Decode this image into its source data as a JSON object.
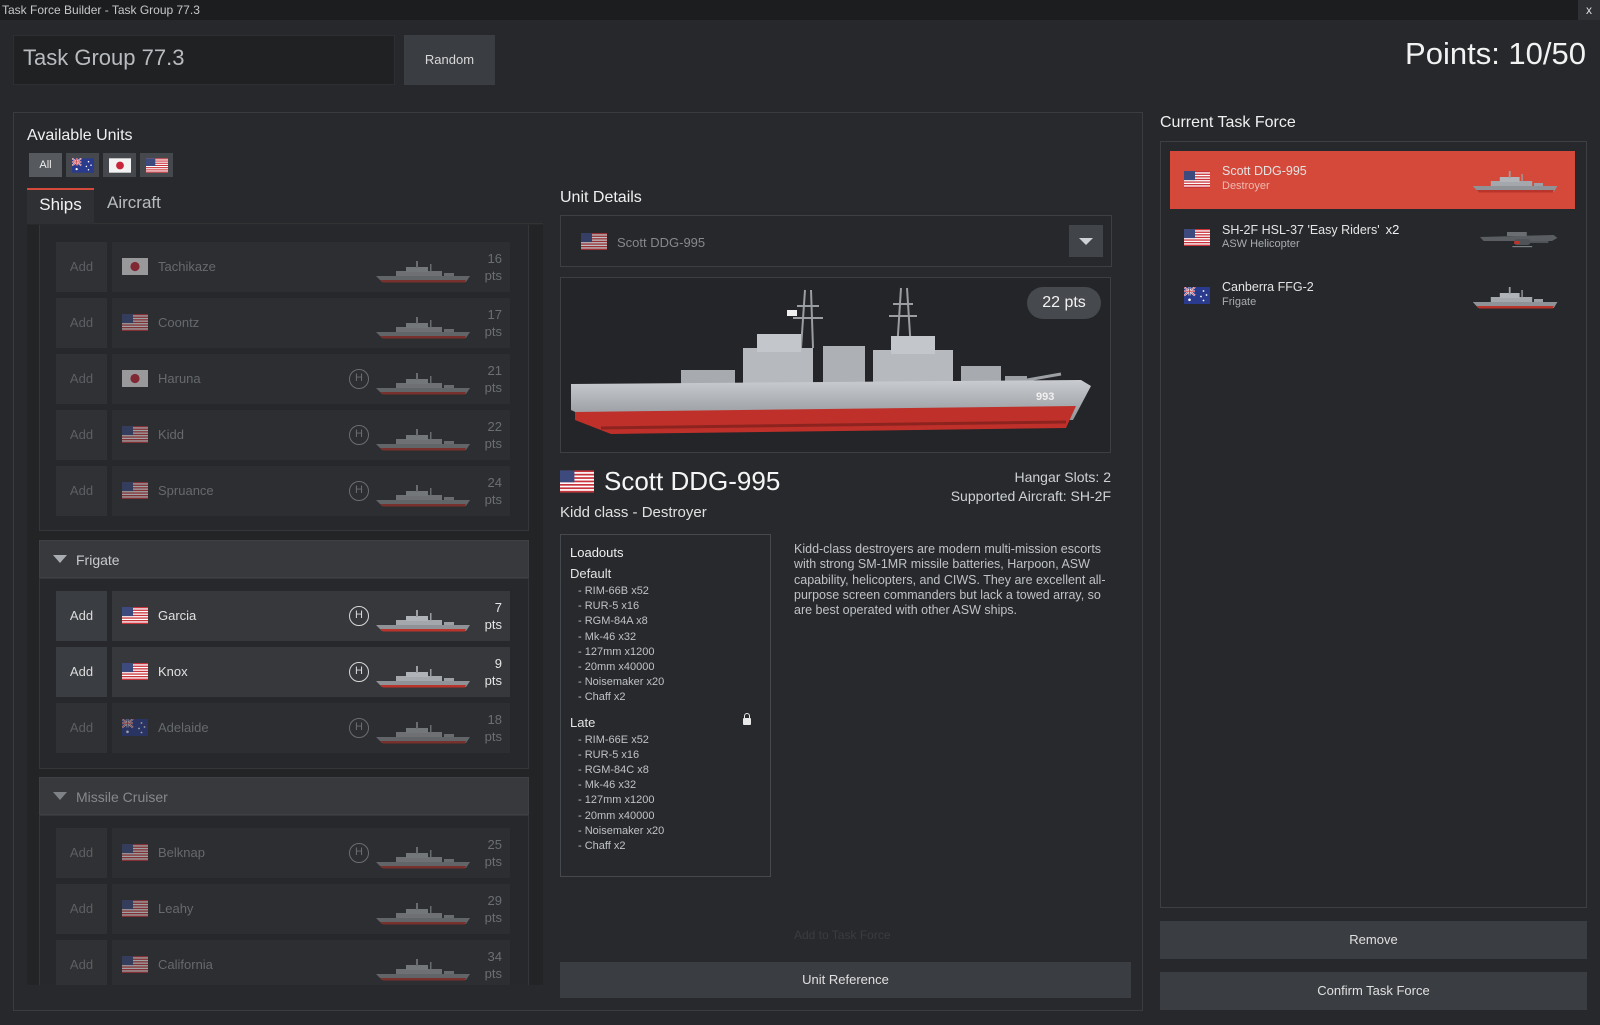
{
  "window": {
    "title": "Task Force Builder - Task Group 77.3",
    "close_label": "x"
  },
  "header": {
    "task_group_name": "Task Group 77.3",
    "random_label": "Random",
    "points": "Points: 10/50"
  },
  "available": {
    "title": "Available Units",
    "filters": [
      {
        "label": "All",
        "icon": "all"
      },
      {
        "label": "",
        "icon": "flag-australia"
      },
      {
        "label": "",
        "icon": "flag-japan"
      },
      {
        "label": "",
        "icon": "flag-usa"
      }
    ],
    "tabs": {
      "ships": "Ships",
      "aircraft": "Aircraft"
    },
    "add_label": "Add",
    "heli_glyph": "H",
    "destroyer_rows": [
      {
        "name": "Tachikaze",
        "flag": "japan",
        "heli": false,
        "pts": "16",
        "unit": "pts"
      },
      {
        "name": "Coontz",
        "flag": "usa",
        "heli": false,
        "pts": "17",
        "unit": "pts"
      },
      {
        "name": "Haruna",
        "flag": "japan",
        "heli": true,
        "pts": "21",
        "unit": "pts"
      },
      {
        "name": "Kidd",
        "flag": "usa",
        "heli": true,
        "pts": "22",
        "unit": "pts"
      },
      {
        "name": "Spruance",
        "flag": "usa",
        "heli": true,
        "pts": "24",
        "unit": "pts"
      }
    ],
    "frigate": {
      "label": "Frigate",
      "rows": [
        {
          "name": "Garcia",
          "flag": "usa",
          "heli": true,
          "pts": "7",
          "unit": "pts",
          "enabled": true
        },
        {
          "name": "Knox",
          "flag": "usa",
          "heli": true,
          "pts": "9",
          "unit": "pts",
          "enabled": true
        },
        {
          "name": "Adelaide",
          "flag": "australia",
          "heli": true,
          "pts": "18",
          "unit": "pts",
          "enabled": false
        }
      ]
    },
    "cruiser": {
      "label": "Missile Cruiser",
      "rows": [
        {
          "name": "Belknap",
          "flag": "usa",
          "heli": true,
          "pts": "25",
          "unit": "pts"
        },
        {
          "name": "Leahy",
          "flag": "usa",
          "heli": false,
          "pts": "29",
          "unit": "pts"
        },
        {
          "name": "California",
          "flag": "usa",
          "heli": false,
          "pts": "34",
          "unit": "pts"
        }
      ]
    }
  },
  "details": {
    "title": "Unit Details",
    "selected": "Scott DDG-995",
    "points_badge": "22 pts",
    "unit_name": "Scott DDG-995",
    "unit_class": "Kidd class - Destroyer",
    "hangar": "Hangar Slots: 2",
    "supported": "Supported Aircraft: SH-2F",
    "loadouts_title": "Loadouts",
    "loadout_default": {
      "name": "Default",
      "items": [
        "RIM-66B x52",
        "RUR-5 x16",
        "RGM-84A x8",
        "Mk-46 x32",
        "127mm x1200",
        "20mm x40000",
        "Noisemaker x20",
        "Chaff x2"
      ]
    },
    "loadout_late": {
      "name": "Late",
      "items": [
        "RIM-66E x52",
        "RUR-5 x16",
        "RGM-84C x8",
        "Mk-46 x32",
        "127mm x1200",
        "20mm x40000",
        "Noisemaker x20",
        "Chaff x2"
      ]
    },
    "description": "Kidd-class destroyers are modern multi-mission escorts with strong SM-1MR missile batteries, Harpoon, ASW capability, helicopters, and CIWS. They are excellent all-purpose screen commanders but lack a towed array, so are best operated with other ASW ships.",
    "add_to_tf": "Add to Task Force",
    "unit_reference": "Unit Reference",
    "hull_number": "993"
  },
  "task_force": {
    "title": "Current Task Force",
    "items": [
      {
        "name": "Scott DDG-995",
        "count": "",
        "type": "Destroyer",
        "flag": "usa",
        "selected": true
      },
      {
        "name": "SH-2F HSL-37 'Easy Riders'",
        "count": "x2",
        "type": "ASW Helicopter",
        "flag": "usa",
        "selected": false
      },
      {
        "name": "Canberra FFG-2",
        "count": "",
        "type": "Frigate",
        "flag": "australia",
        "selected": false
      }
    ],
    "remove_label": "Remove",
    "confirm_label": "Confirm Task Force"
  },
  "colors": {
    "accent": "#d4493a",
    "background": "#26282b",
    "panel": "#2c2e31"
  }
}
